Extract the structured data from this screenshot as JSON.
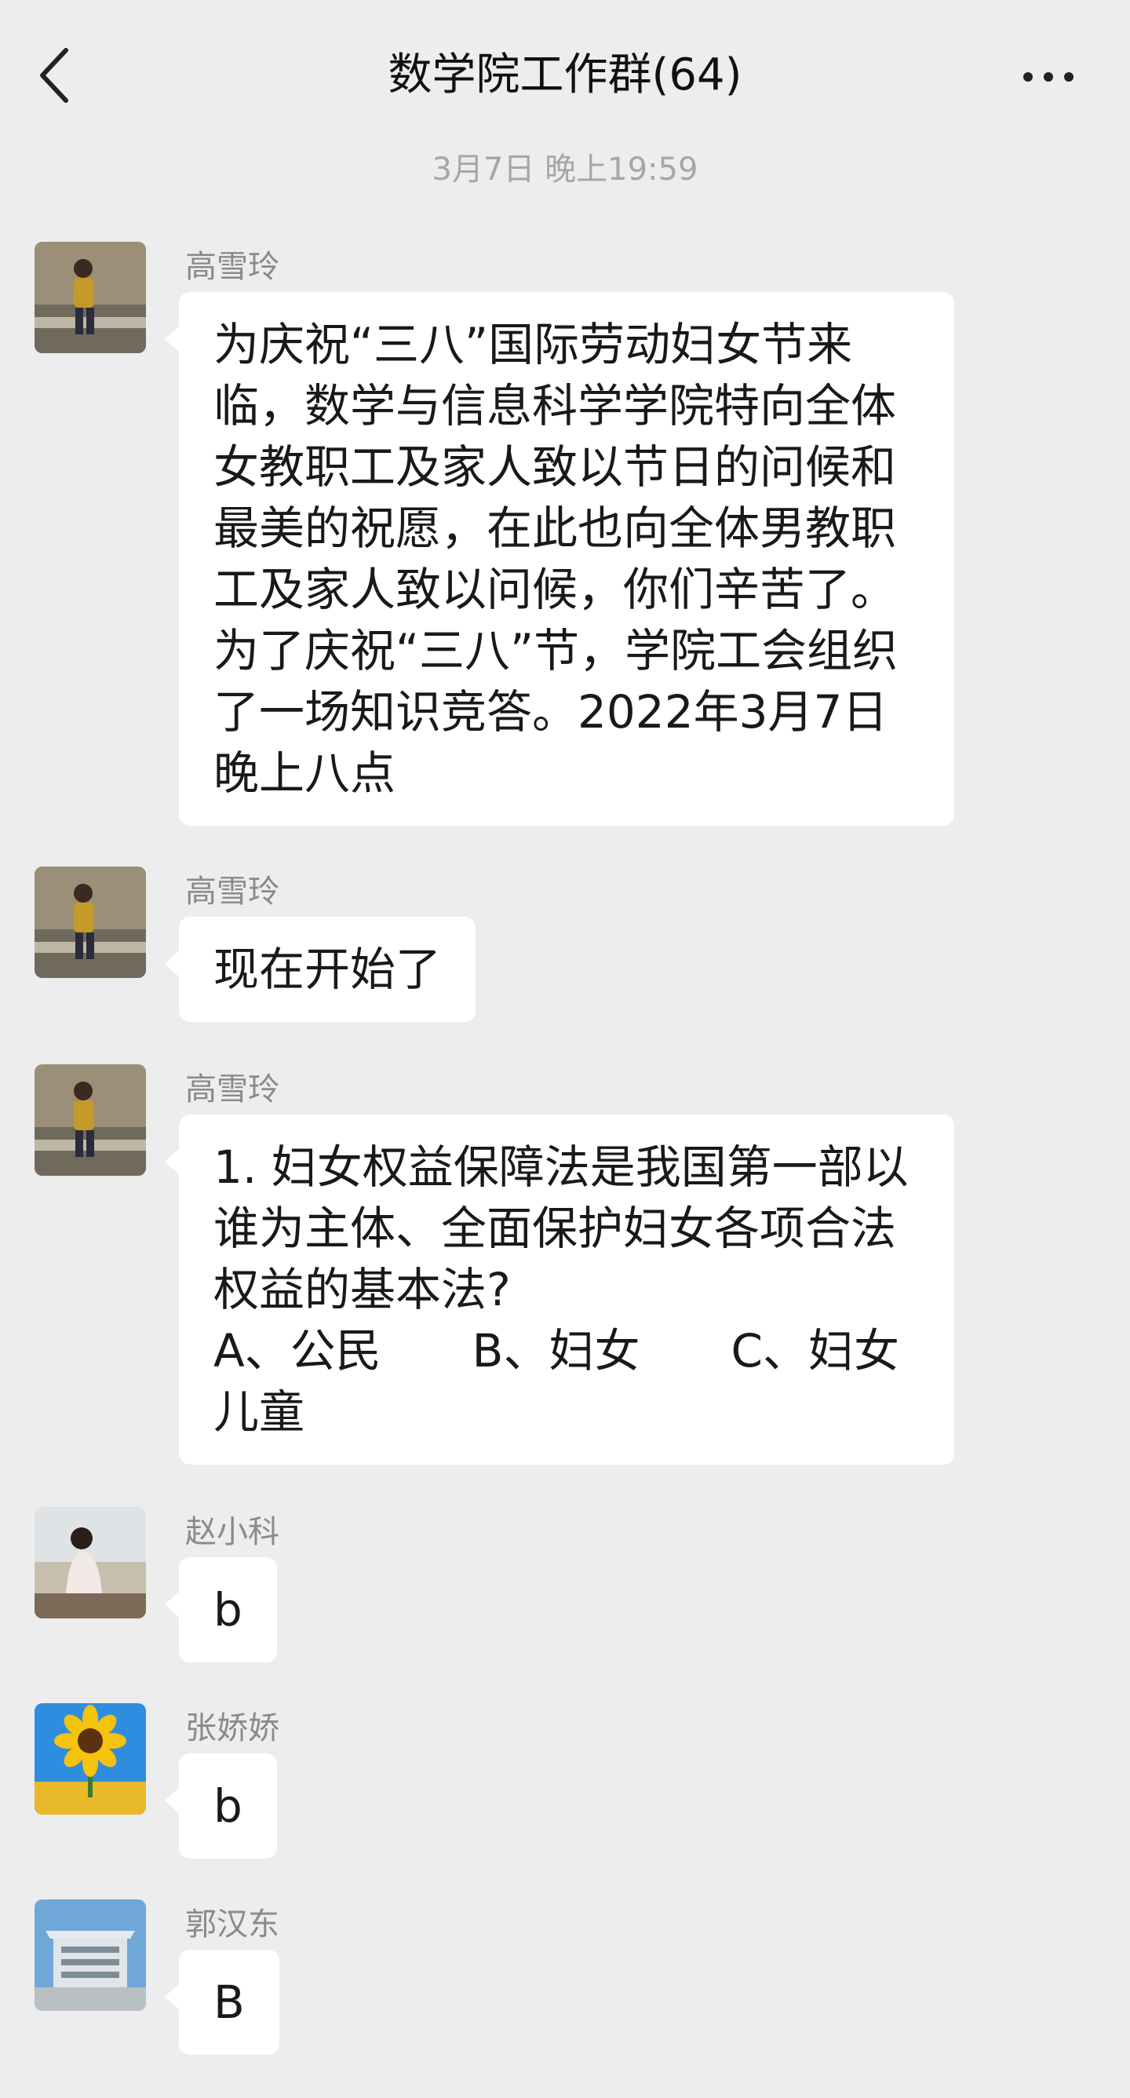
{
  "header": {
    "title": "数学院工作群(64)",
    "back_icon": "chevron-left-icon",
    "more_icon": "more-horizontal-icon"
  },
  "timestamp": "3月7日 晚上19:59",
  "messages": [
    {
      "sender": "高雪玲",
      "avatar": "avatar-gao-xueling",
      "text": "为庆祝“三八”国际劳动妇女节来临，数学与信息科学学院特向全体女教职工及家人致以节日的问候和最美的祝愿，在此也向全体男教职工及家人致以问候，你们辛苦了。为了庆祝“三八”节，学院工会组织了一场知识竞答。2022年3月7日晚上八点"
    },
    {
      "sender": "高雪玲",
      "avatar": "avatar-gao-xueling",
      "text": "现在开始了"
    },
    {
      "sender": "高雪玲",
      "avatar": "avatar-gao-xueling",
      "text": "1. 妇女权益保障法是我国第一部以谁为主体、全面保护妇女各项合法权益的基本法?\nA、公民　　B、妇女　　C、妇女儿童"
    },
    {
      "sender": "赵小科",
      "avatar": "avatar-zhao-xiaoke",
      "text": "b"
    },
    {
      "sender": "张娇娇",
      "avatar": "avatar-zhang-jiaojiao-sunflower",
      "text": "b"
    },
    {
      "sender": "郭汉东",
      "avatar": "avatar-guo-handong-building",
      "text": "B"
    }
  ],
  "colors": {
    "background": "#ededed",
    "bubble": "#ffffff",
    "sender_name": "#8a8a8a",
    "timestamp": "#a6a6a6"
  }
}
